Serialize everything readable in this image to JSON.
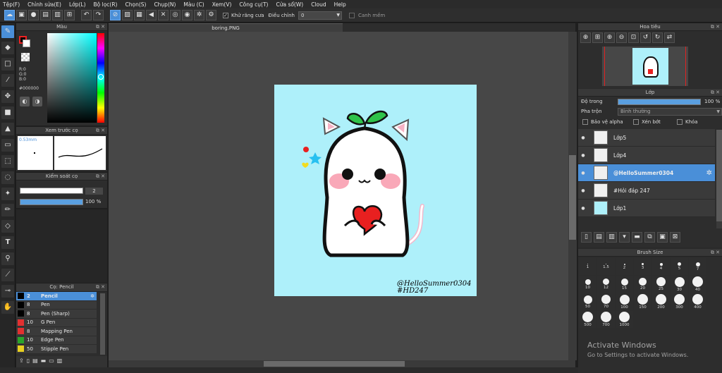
{
  "menu": [
    "Tệp(F)",
    "Chỉnh sửa(E)",
    "Lớp(L)",
    "Bộ lọc(R)",
    "Chọn(S)",
    "Chụp(N)",
    "Màu (C)",
    "Xem(V)",
    "Công cụ(T)",
    "Cửa sổ(W)",
    "Cloud",
    "Help"
  ],
  "toolbar": {
    "antialias_label": "Khử răng cưa",
    "adjust_label": "Điều chỉnh",
    "adjust_value": "0",
    "smooth_label": "Canh mềm"
  },
  "doc_tab": "boring.PNG",
  "color_panel": {
    "title": "Màu",
    "r": "R:0",
    "g": "G:0",
    "b": "B:0",
    "hex": "#000000"
  },
  "preview_panel": {
    "title": "Xem trước cọ",
    "size": "0.53mm"
  },
  "brush_control": {
    "title": "Kiểm soát cọ",
    "size_value": "2",
    "opacity_value": "100 %"
  },
  "sub_tool": {
    "title": "Cọ: Pencil",
    "items": [
      {
        "size": "2",
        "name": "Pencil",
        "color": "#000000",
        "selected": true
      },
      {
        "size": "8",
        "name": "Pen",
        "color": "#000000",
        "selected": false
      },
      {
        "size": "8",
        "name": "Pen (Sharp)",
        "color": "#000000",
        "selected": false
      },
      {
        "size": "10",
        "name": "G Pen",
        "color": "#e23030",
        "selected": false
      },
      {
        "size": "8",
        "name": "Mapping Pen",
        "color": "#e23030",
        "selected": false
      },
      {
        "size": "10",
        "name": "Edge Pen",
        "color": "#2aa52a",
        "selected": false
      },
      {
        "size": "50",
        "name": "Stipple Pen",
        "color": "#e8d020",
        "selected": false
      }
    ]
  },
  "navigator": {
    "title": "Hoa tiêu"
  },
  "layer_panel": {
    "title": "Lớp",
    "opacity_label": "Độ trong",
    "opacity_value": "100 %",
    "blend_label": "Pha trộn",
    "blend_value": "Bình thường",
    "protect_alpha": "Bảo vệ alpha",
    "clipping": "Xén bớt",
    "lock": "Khóa",
    "layers": [
      {
        "name": "Lớp5",
        "selected": false
      },
      {
        "name": "Lớp4",
        "selected": false
      },
      {
        "name": "@HelloSummer0304",
        "selected": true
      },
      {
        "name": "#Hỏi đáp 247",
        "selected": false
      },
      {
        "name": "Lớp1",
        "selected": false
      }
    ]
  },
  "brush_size": {
    "title": "Brush Size",
    "sizes": [
      "1",
      "1.5",
      "2",
      "3",
      "4",
      "5",
      "7",
      "10",
      "12",
      "15",
      "20",
      "25",
      "30",
      "40",
      "50",
      "70",
      "100",
      "150",
      "200",
      "300",
      "400",
      "500",
      "700",
      "1000"
    ]
  },
  "canvas": {
    "signature_line1": "@HelloSummer0304",
    "signature_line2": "#HD247"
  },
  "watermark": {
    "line1": "Activate Windows",
    "line2": "Go to Settings to activate Windows."
  }
}
